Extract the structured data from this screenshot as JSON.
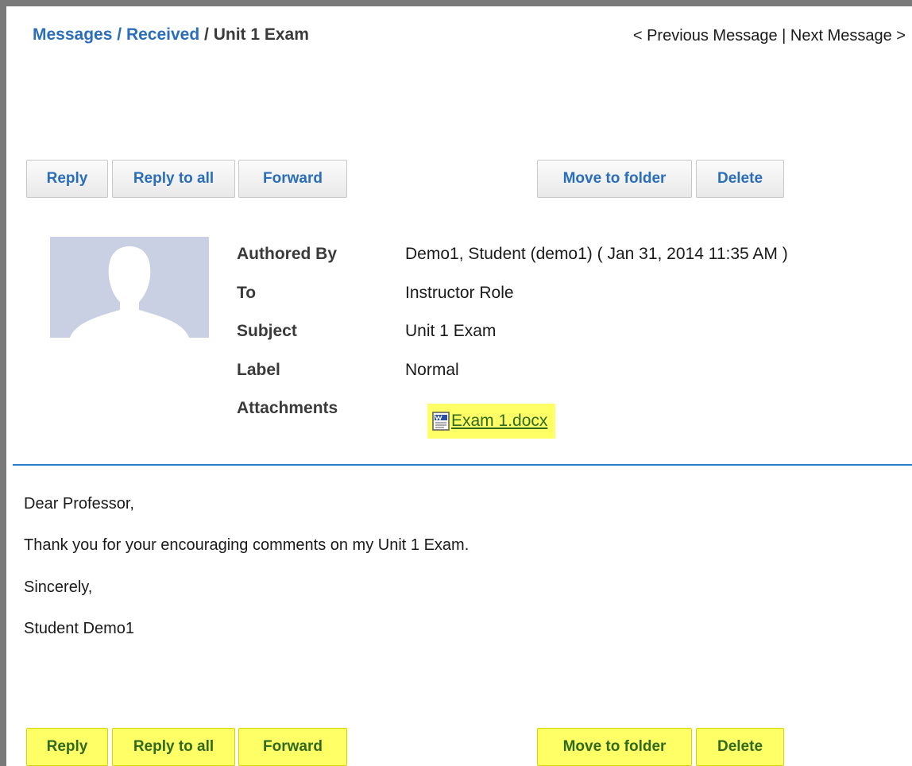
{
  "breadcrumb": {
    "messages": "Messages",
    "sep1": "/",
    "received": "Received",
    "sep2": "/",
    "current": "Unit 1 Exam"
  },
  "pager": {
    "previous": "< Previous Message",
    "separator": "|",
    "next": "Next Message >"
  },
  "toolbar_top": {
    "reply": "Reply",
    "reply_all": "Reply to all",
    "forward": "Forward",
    "move_to_folder": "Move to folder",
    "delete": "Delete"
  },
  "header": {
    "authored_by_label": "Authored By",
    "authored_by_value": "Demo1, Student (demo1) ( Jan 31, 2014 11:35 AM )",
    "to_label": "To",
    "to_value": "Instructor Role",
    "subject_label": "Subject",
    "subject_value": "Unit 1 Exam",
    "label_label": "Label",
    "label_value": "Normal",
    "attachments_label": "Attachments",
    "attachment_file": "Exam 1.docx"
  },
  "body": {
    "line1": "Dear Professor,",
    "line2": "Thank you for your encouraging comments on my Unit 1 Exam.",
    "line3": "Sincerely,",
    "line4": "Student Demo1"
  },
  "toolbar_bottom": {
    "reply": "Reply",
    "reply_all": "Reply to all",
    "forward": "Forward",
    "move_to_folder": "Move to folder",
    "delete": "Delete"
  },
  "colors": {
    "link_blue": "#2a6ebb",
    "highlight_yellow": "#ffff66",
    "divider_blue": "#2a7fc8",
    "avatar_bg": "#c9d0e3"
  },
  "icons": {
    "avatar": "person-silhouette-icon",
    "attachment": "word-document-icon"
  }
}
